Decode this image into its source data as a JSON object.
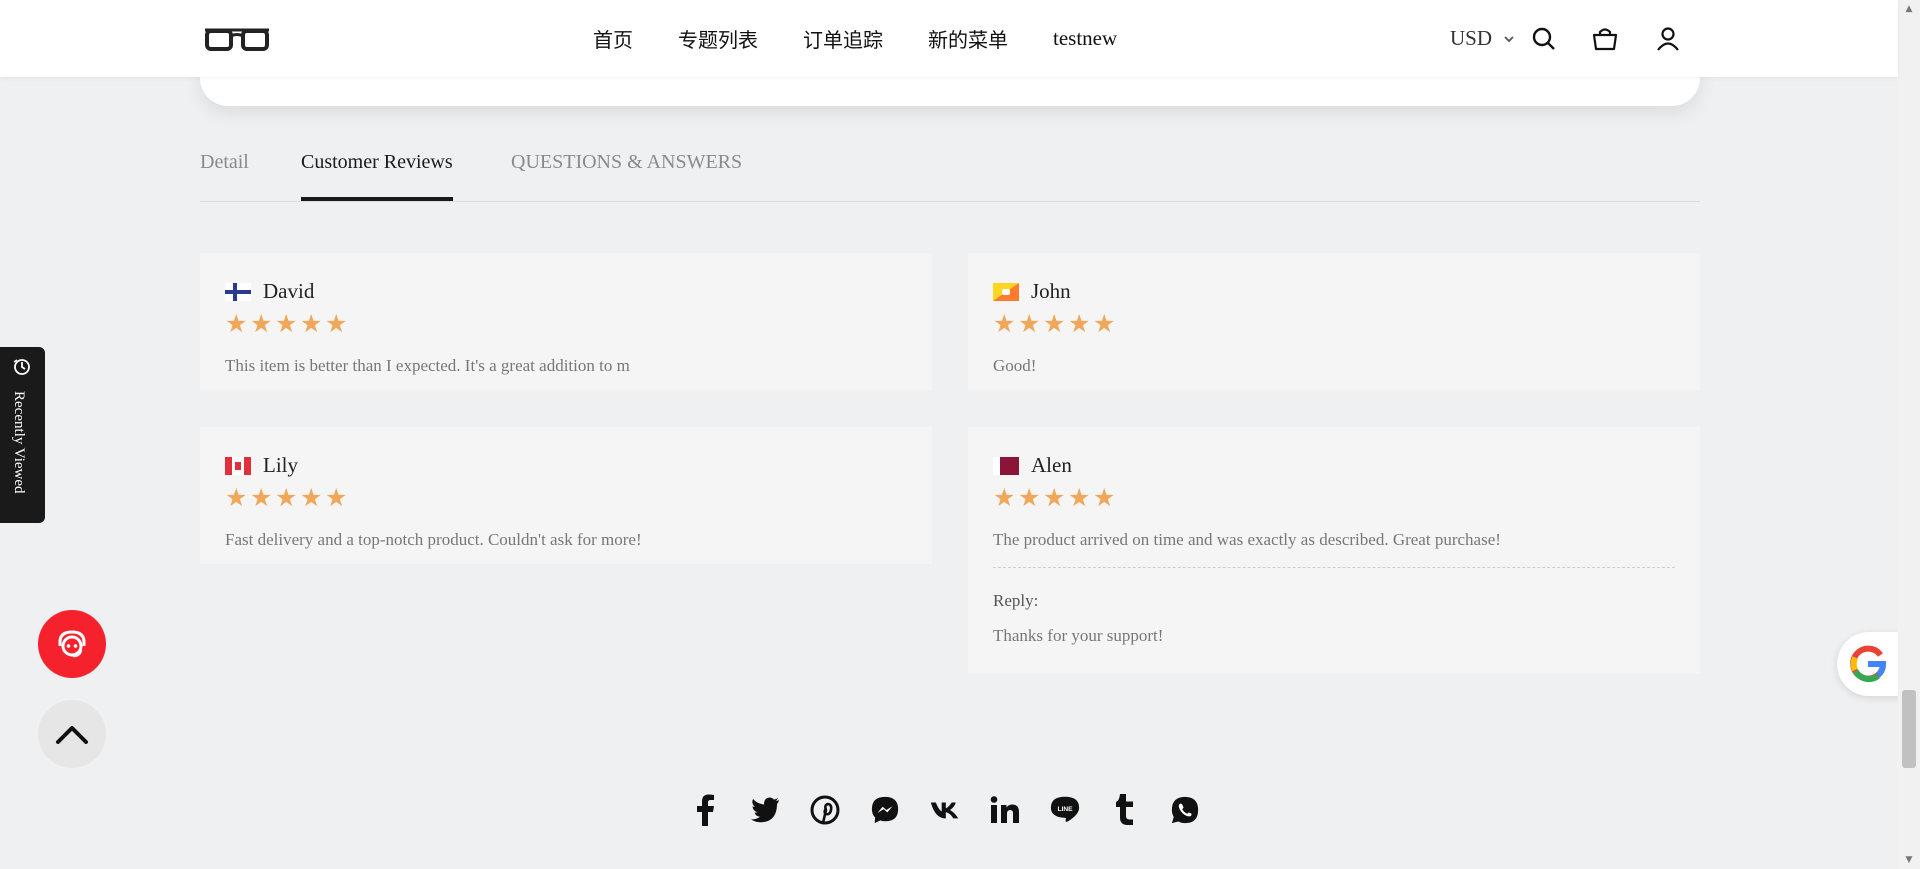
{
  "header": {
    "nav": [
      "首页",
      "专题列表",
      "订单追踪",
      "新的菜单",
      "testnew"
    ],
    "currency": "USD"
  },
  "tabs": [
    "Detail",
    "Customer Reviews",
    "QUESTIONS & ANSWERS"
  ],
  "reviews": [
    {
      "name": "David",
      "rating": 5,
      "text": "This item is better than I expected. It's a great addition to m"
    },
    {
      "name": "John",
      "rating": 5,
      "text": "Good!"
    },
    {
      "name": "Lily",
      "rating": 5,
      "text": "Fast delivery and a top-notch product. Couldn't ask for more!"
    },
    {
      "name": "Alen",
      "rating": 5,
      "text": "The product arrived on time and was exactly as described. Great purchase!",
      "reply_label": "Reply:",
      "reply_text": "Thanks for your support!"
    }
  ],
  "sidebar": {
    "recently_viewed": "Recently Viewed"
  },
  "social": [
    "facebook-icon",
    "twitter-icon",
    "pinterest-icon",
    "messenger-icon",
    "vk-icon",
    "linkedin-icon",
    "line-icon",
    "tumblr-icon",
    "whatsapp-icon"
  ],
  "colors": {
    "star": "#f1a75a",
    "support": "#f5222d",
    "background": "#eff0f2"
  }
}
